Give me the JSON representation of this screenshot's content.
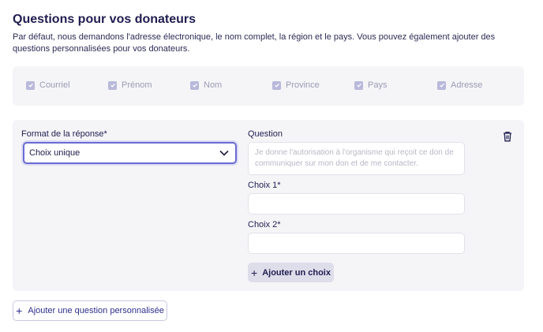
{
  "section": {
    "title": "Questions pour vos donateurs",
    "description": "Par défaut, nous demandons l'adresse électronique, le nom complet, la région et le pays. Vous pouvez également ajouter des questions personnalisées pour vos donateurs."
  },
  "default_fields": [
    {
      "label": "Courriel",
      "checked": true
    },
    {
      "label": "Prénom",
      "checked": true
    },
    {
      "label": "Nom",
      "checked": true
    },
    {
      "label": "Province",
      "checked": true
    },
    {
      "label": "Pays",
      "checked": true
    },
    {
      "label": "Adresse",
      "checked": true
    }
  ],
  "question_card": {
    "format_label": "Format de la réponse*",
    "format_value": "Choix unique",
    "question_label": "Question",
    "question_placeholder": "Je donne l'autorisation à l'organisme qui reçoit ce don de communiquer sur mon don et de me contacter.",
    "choice1_label": "Choix 1*",
    "choice1_value": "",
    "choice2_label": "Choix 2*",
    "choice2_value": "",
    "add_choice_label": "Ajouter un choix",
    "delete_icon": "trash-icon"
  },
  "add_question_label": "Ajouter une question personnalisée",
  "colors": {
    "accent": "#6a6ad3",
    "text": "#1f1d4f",
    "muted": "#9b9bb4",
    "panel": "#f5f5f8"
  }
}
